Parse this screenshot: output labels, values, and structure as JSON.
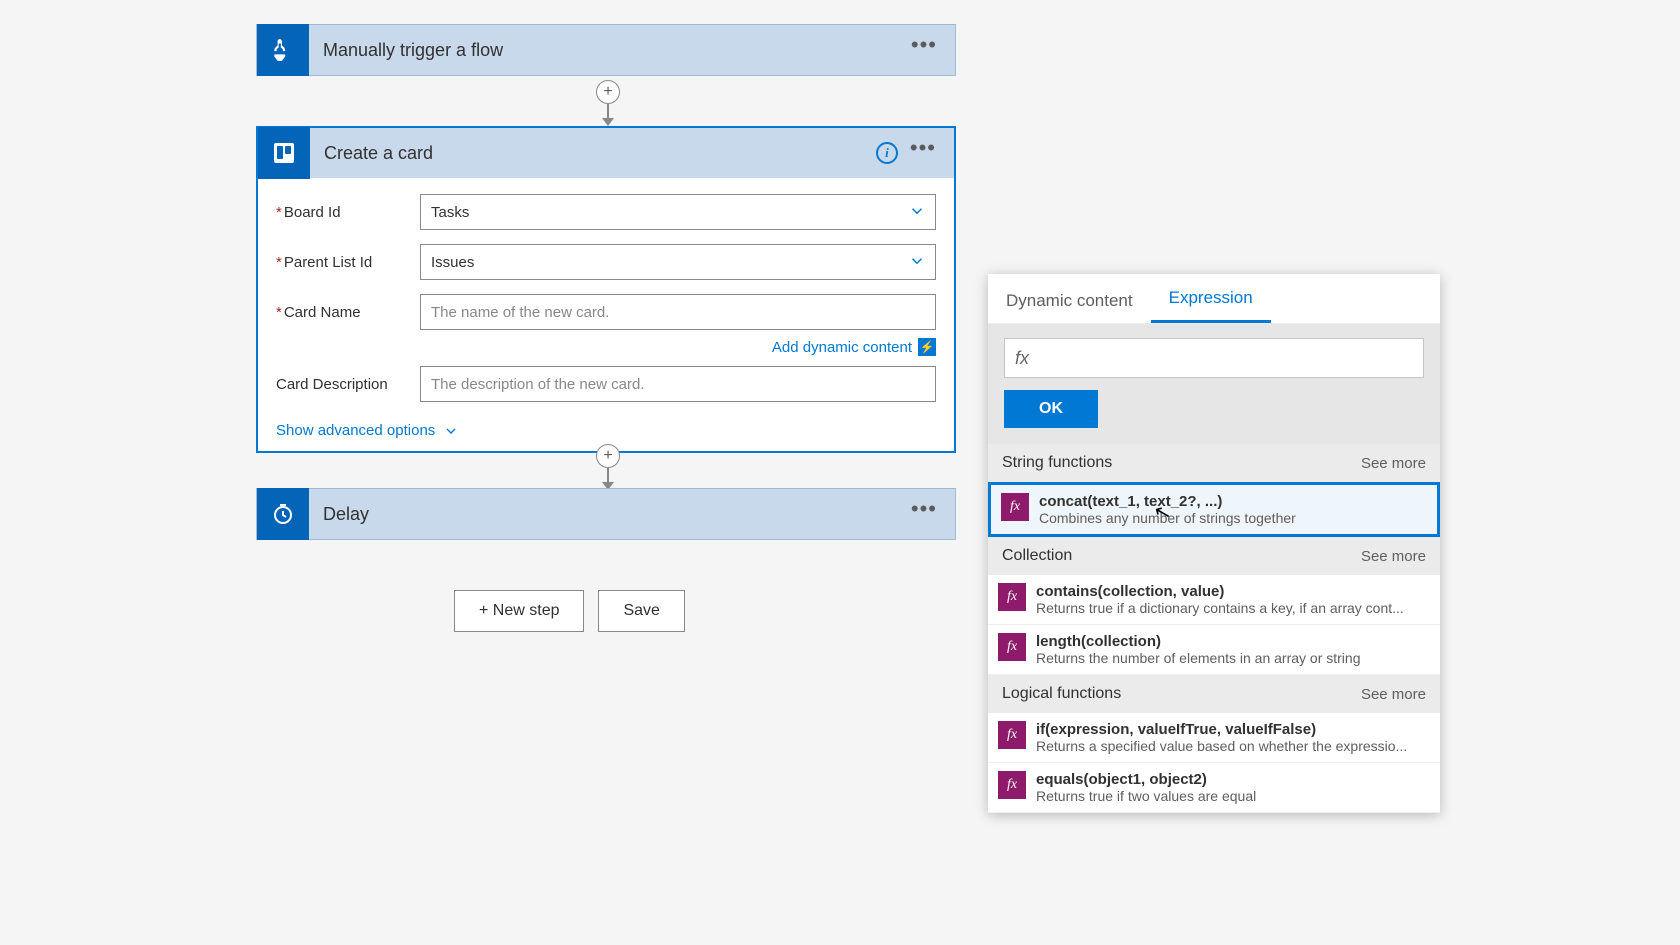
{
  "steps": {
    "trigger": {
      "title": "Manually trigger a flow"
    },
    "create_card": {
      "title": "Create a card",
      "fields": {
        "board_id": {
          "label": "Board Id",
          "value": "Tasks"
        },
        "parent_list_id": {
          "label": "Parent List Id",
          "value": "Issues"
        },
        "card_name": {
          "label": "Card Name",
          "placeholder": "The name of the new card."
        },
        "card_description": {
          "label": "Card Description",
          "placeholder": "The description of the new card."
        }
      },
      "add_dynamic_content": "Add dynamic content",
      "advanced_options": "Show advanced options"
    },
    "delay": {
      "title": "Delay"
    }
  },
  "buttons": {
    "new_step": "+ New step",
    "save": "Save"
  },
  "expression_panel": {
    "tabs": {
      "dynamic": "Dynamic content",
      "expression": "Expression"
    },
    "fx_prefix": "fx",
    "ok": "OK",
    "see_more": "See more",
    "categories": [
      {
        "name": "String functions",
        "items": [
          {
            "sig": "concat(text_1, text_2?, ...)",
            "desc": "Combines any number of strings together",
            "highlighted": true
          }
        ]
      },
      {
        "name": "Collection",
        "items": [
          {
            "sig": "contains(collection, value)",
            "desc": "Returns true if a dictionary contains a key, if an array cont..."
          },
          {
            "sig": "length(collection)",
            "desc": "Returns the number of elements in an array or string"
          }
        ]
      },
      {
        "name": "Logical functions",
        "items": [
          {
            "sig": "if(expression, valueIfTrue, valueIfFalse)",
            "desc": "Returns a specified value based on whether the expressio..."
          },
          {
            "sig": "equals(object1, object2)",
            "desc": "Returns true if two values are equal"
          }
        ]
      }
    ]
  }
}
